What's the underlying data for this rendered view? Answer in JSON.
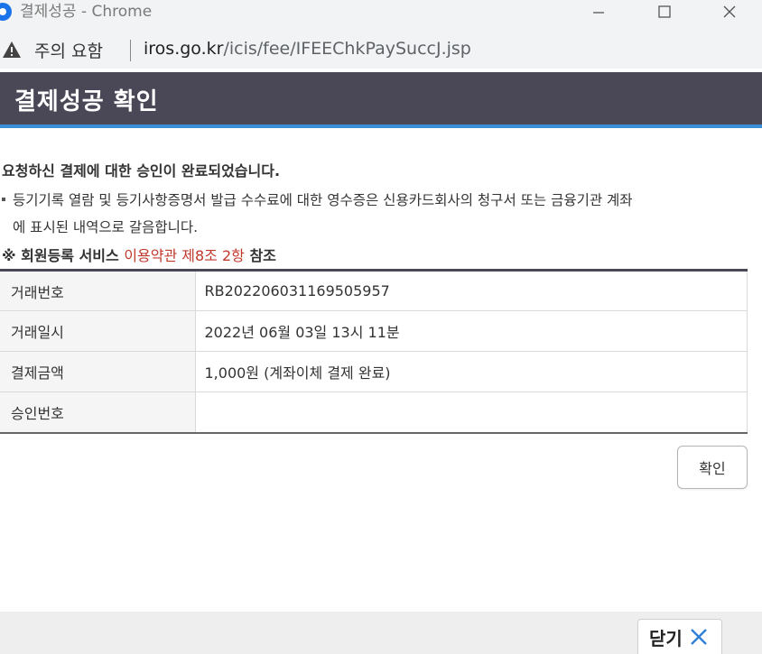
{
  "window": {
    "title": "결제성공 - Chrome",
    "minimize_icon": "minimize-icon",
    "maximize_icon": "maximize-icon",
    "close_icon": "close-icon"
  },
  "addressbar": {
    "security_label": "주의 요함",
    "url_host": "iros.go.kr",
    "url_path": "/icis/fee/IFEEChkPaySuccJ.jsp"
  },
  "header": {
    "title": "결제성공 확인",
    "accent_color": "#3b8ed8",
    "bg_color": "#4a4857"
  },
  "messages": {
    "main": "요청하신 결제에 대한 승인이 완료되었습니다.",
    "note_line1": "등기기록 열람 및 등기사항증명서 발급 수수료에 대한 영수증은 신용카드회사의 청구서 또는 금융기관 계좌",
    "note_line2": "에 표시된 내역으로 갈음합니다.",
    "ref_prefix": "※ 회원등록 서비스 ",
    "ref_link": "이용약관 제8조 2항",
    "ref_suffix": " 참조"
  },
  "table": {
    "rows": [
      {
        "label": "거래번호",
        "value": "RB202206031169505957"
      },
      {
        "label": "거래일시",
        "value": "2022년 06월 03일 13시 11분"
      },
      {
        "label": "결제금액",
        "value": "1,000원 (계좌이체 결제 완료)"
      },
      {
        "label": "승인번호",
        "value": ""
      }
    ]
  },
  "buttons": {
    "confirm": "확인",
    "close": "닫기"
  }
}
